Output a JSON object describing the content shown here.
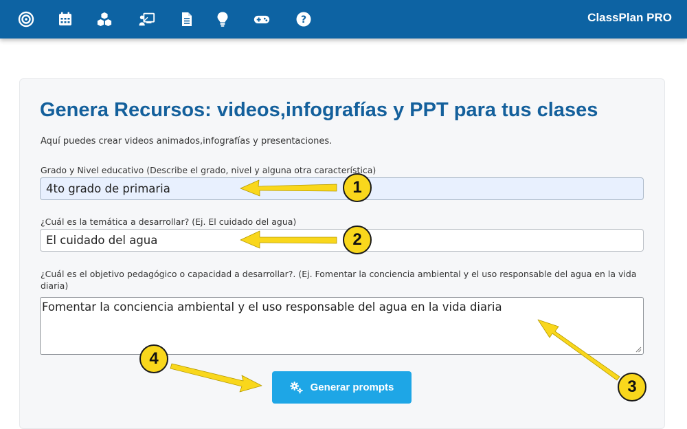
{
  "app": {
    "brand": "ClassPlan PRO"
  },
  "nav": {
    "icons": [
      "target-icon",
      "calendar-icon",
      "cubes-icon",
      "presentation-icon",
      "document-icon",
      "lightbulb-icon",
      "gamepad-icon",
      "help-icon"
    ]
  },
  "main": {
    "title": "Genera Recursos: videos,infografías y PPT para tus clases",
    "subtitle": "Aquí puedes crear videos animados,infografías y presentaciones.",
    "grade": {
      "label": "Grado y Nivel educativo (Describe el grado, nivel y alguna otra característica)",
      "value": "4to grado de primaria"
    },
    "topic": {
      "label": "¿Cuál es la temática a desarrollar? (Ej. El cuidado del agua)",
      "value": "El cuidado del agua"
    },
    "objective": {
      "label": "¿Cuál es el objetivo pedagógico o capacidad a desarrollar?. (Ej. Fomentar la conciencia ambiental y el uso responsable del agua en la vida diaria)",
      "value": "Fomentar la conciencia ambiental y el uso responsable del agua en la vida diaria"
    },
    "generate_button": {
      "label": "Generar prompts",
      "icon": "gears-icon"
    }
  },
  "annotations": {
    "badges": [
      "1",
      "2",
      "3",
      "4"
    ],
    "colors": {
      "badge_fill": "#f9d71c",
      "arrow": "#f9d71c",
      "outline": "#1a1a1a"
    }
  },
  "colors": {
    "topbar": "#0d63a3",
    "title": "#14609c",
    "button": "#1ea6e6",
    "filled_input": "#e8f0fe"
  }
}
